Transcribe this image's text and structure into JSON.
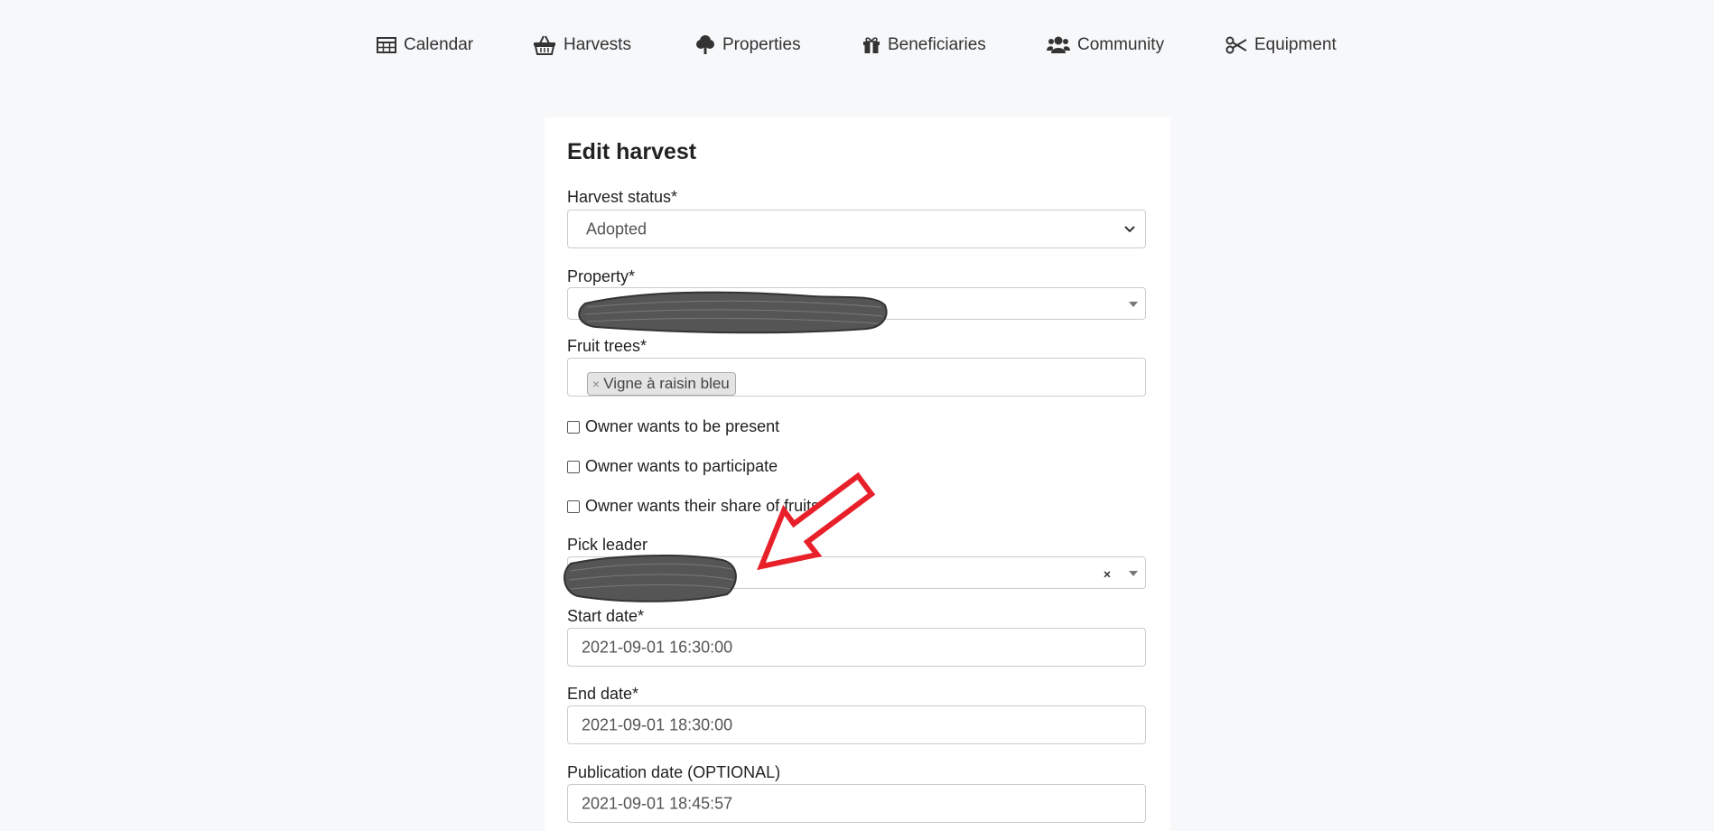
{
  "nav": {
    "calendar": "Calendar",
    "harvests": "Harvests",
    "properties": "Properties",
    "beneficiaries": "Beneficiaries",
    "community": "Community",
    "equipment": "Equipment"
  },
  "form": {
    "title": "Edit harvest",
    "status_label": "Harvest status*",
    "status_value": "Adopted",
    "property_label": "Property*",
    "fruit_trees_label": "Fruit trees*",
    "fruit_tree_tag": "Vigne à raisin bleu",
    "tag_remove": "×",
    "checkbox_present": "Owner wants to be present",
    "checkbox_participate": "Owner wants to participate",
    "checkbox_share": "Owner wants their share of fruits",
    "pick_leader_label": "Pick leader",
    "pick_leader_clear": "×",
    "start_date_label": "Start date*",
    "start_date_value": "2021-09-01 16:30:00",
    "end_date_label": "End date*",
    "end_date_value": "2021-09-01 18:30:00",
    "publication_label": "Publication date (OPTIONAL)",
    "publication_value": "2021-09-01 18:45:57"
  },
  "colors": {
    "background": "#f7f8fa",
    "annotation_arrow": "#e8202a",
    "redaction_scribble": "#555555"
  }
}
